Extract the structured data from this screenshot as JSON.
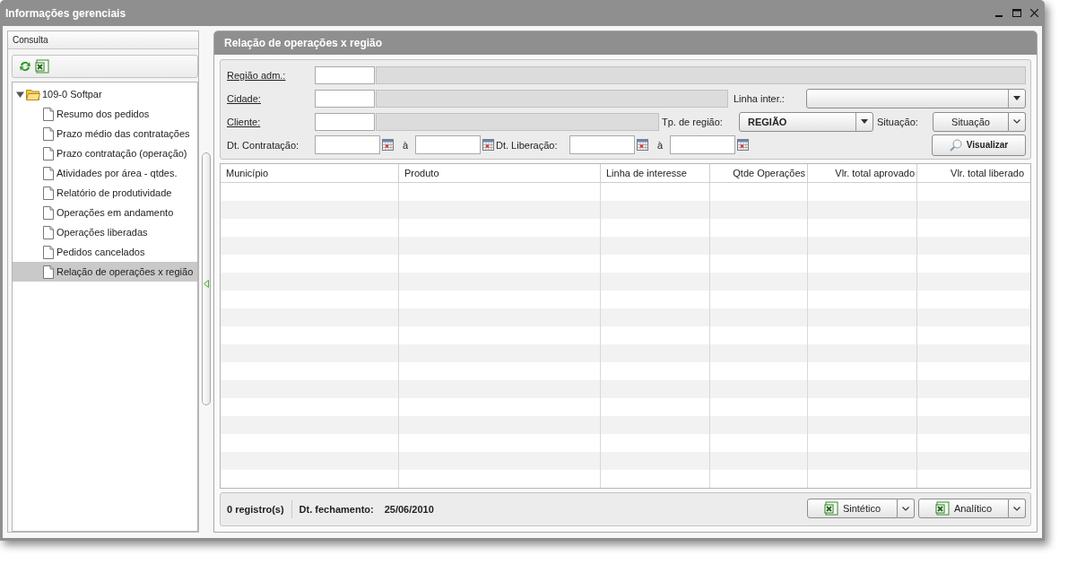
{
  "window": {
    "title": "Informações gerenciais"
  },
  "sidebar": {
    "header": "Consulta",
    "tree": [
      {
        "label": "109-0 Softpar",
        "expanded": true,
        "children": [
          {
            "label": "Resumo dos pedidos",
            "selected": false
          },
          {
            "label": "Prazo médio das contratações",
            "selected": false
          },
          {
            "label": "Prazo contratação (operação)",
            "selected": false
          },
          {
            "label": "Atividades por área - qtdes.",
            "selected": false
          },
          {
            "label": "Relatório de produtividade",
            "selected": false
          },
          {
            "label": "Operações em andamento",
            "selected": false
          },
          {
            "label": "Operações liberadas",
            "selected": false
          },
          {
            "label": "Pedidos cancelados",
            "selected": false
          },
          {
            "label": "Relação de operações x região",
            "selected": true
          }
        ]
      }
    ]
  },
  "panel": {
    "title": "Relação de operações x região",
    "filters": {
      "regiao_adm": {
        "label": "Região adm.:"
      },
      "cidade": {
        "label": "Cidade:"
      },
      "cliente": {
        "label": "Cliente:"
      },
      "linha_inter": {
        "label": "Linha inter.:"
      },
      "tp_regiao": {
        "label": "Tp. de região:",
        "value": "REGIÃO"
      },
      "situacao": {
        "label": "Situação:",
        "button": "Situação"
      },
      "dt_contratacao": {
        "label": "Dt. Contratação:",
        "separator": "à"
      },
      "dt_liberacao": {
        "label": "Dt. Liberação:",
        "separator": "à"
      },
      "visualizar": "Visualizar"
    },
    "table": {
      "columns": [
        {
          "label": "Município",
          "kind": "text"
        },
        {
          "label": "Produto",
          "kind": "text"
        },
        {
          "label": "Linha de interesse",
          "kind": "text"
        },
        {
          "label": "Qtde Operações",
          "kind": "number"
        },
        {
          "label": "Vlr. total aprovado",
          "kind": "number"
        },
        {
          "label": "Vlr. total liberado",
          "kind": "number"
        }
      ]
    },
    "status": {
      "count": "0 registro(s)",
      "closing_label": "Dt. fechamento:",
      "closing_date": "25/06/2010"
    },
    "export_buttons": [
      "Sintético",
      "Analítico"
    ]
  }
}
